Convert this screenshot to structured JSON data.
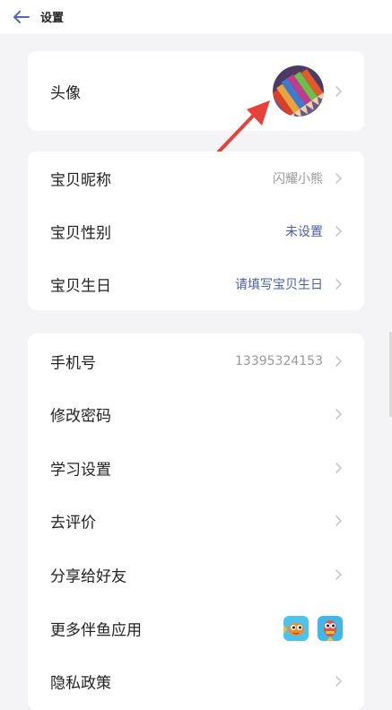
{
  "header": {
    "title": "设置",
    "back_icon": "back-arrow-icon"
  },
  "colors": {
    "accent_blue": "#4a5ea9",
    "secondary_gray": "#999999",
    "annotation_red": "#e8403a",
    "background": "#f4f4f6"
  },
  "profile": {
    "avatar_label": "头像"
  },
  "baby": {
    "nickname_label": "宝贝昵称",
    "nickname_value": "闪耀小熊",
    "gender_label": "宝贝性别",
    "gender_value": "未设置",
    "birthday_label": "宝贝生日",
    "birthday_value": "请填写宝贝生日"
  },
  "account": {
    "phone_label": "手机号",
    "phone_value": "13395324153",
    "password_label": "修改密码",
    "study_label": "学习设置",
    "review_label": "去评价",
    "share_label": "分享给好友",
    "more_apps_label": "更多伴鱼应用",
    "privacy_label": "隐私政策"
  }
}
